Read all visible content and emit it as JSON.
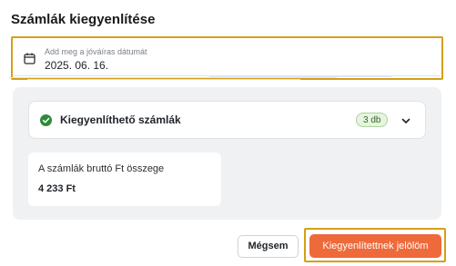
{
  "dialog": {
    "title": "Számlák kiegyenlítése"
  },
  "date_field": {
    "label": "Add meg a jóváíras dátumát",
    "value": "2025. 06. 16.",
    "icon": "calendar-icon"
  },
  "accordion": {
    "label": "Kiegyenlíthető számlák",
    "badge": "3 db",
    "status_icon": "check-circle-icon",
    "toggle_icon": "chevron-down-icon"
  },
  "summary": {
    "label": "A számlák bruttó Ft összege",
    "value": "4 233 Ft"
  },
  "actions": {
    "cancel_label": "Mégsem",
    "confirm_label": "Kiegyenlítettnek jelölöm"
  },
  "colors": {
    "accent": "#ee6a3a",
    "success": "#2e8b3a",
    "highlight_frame": "#d4a017"
  }
}
